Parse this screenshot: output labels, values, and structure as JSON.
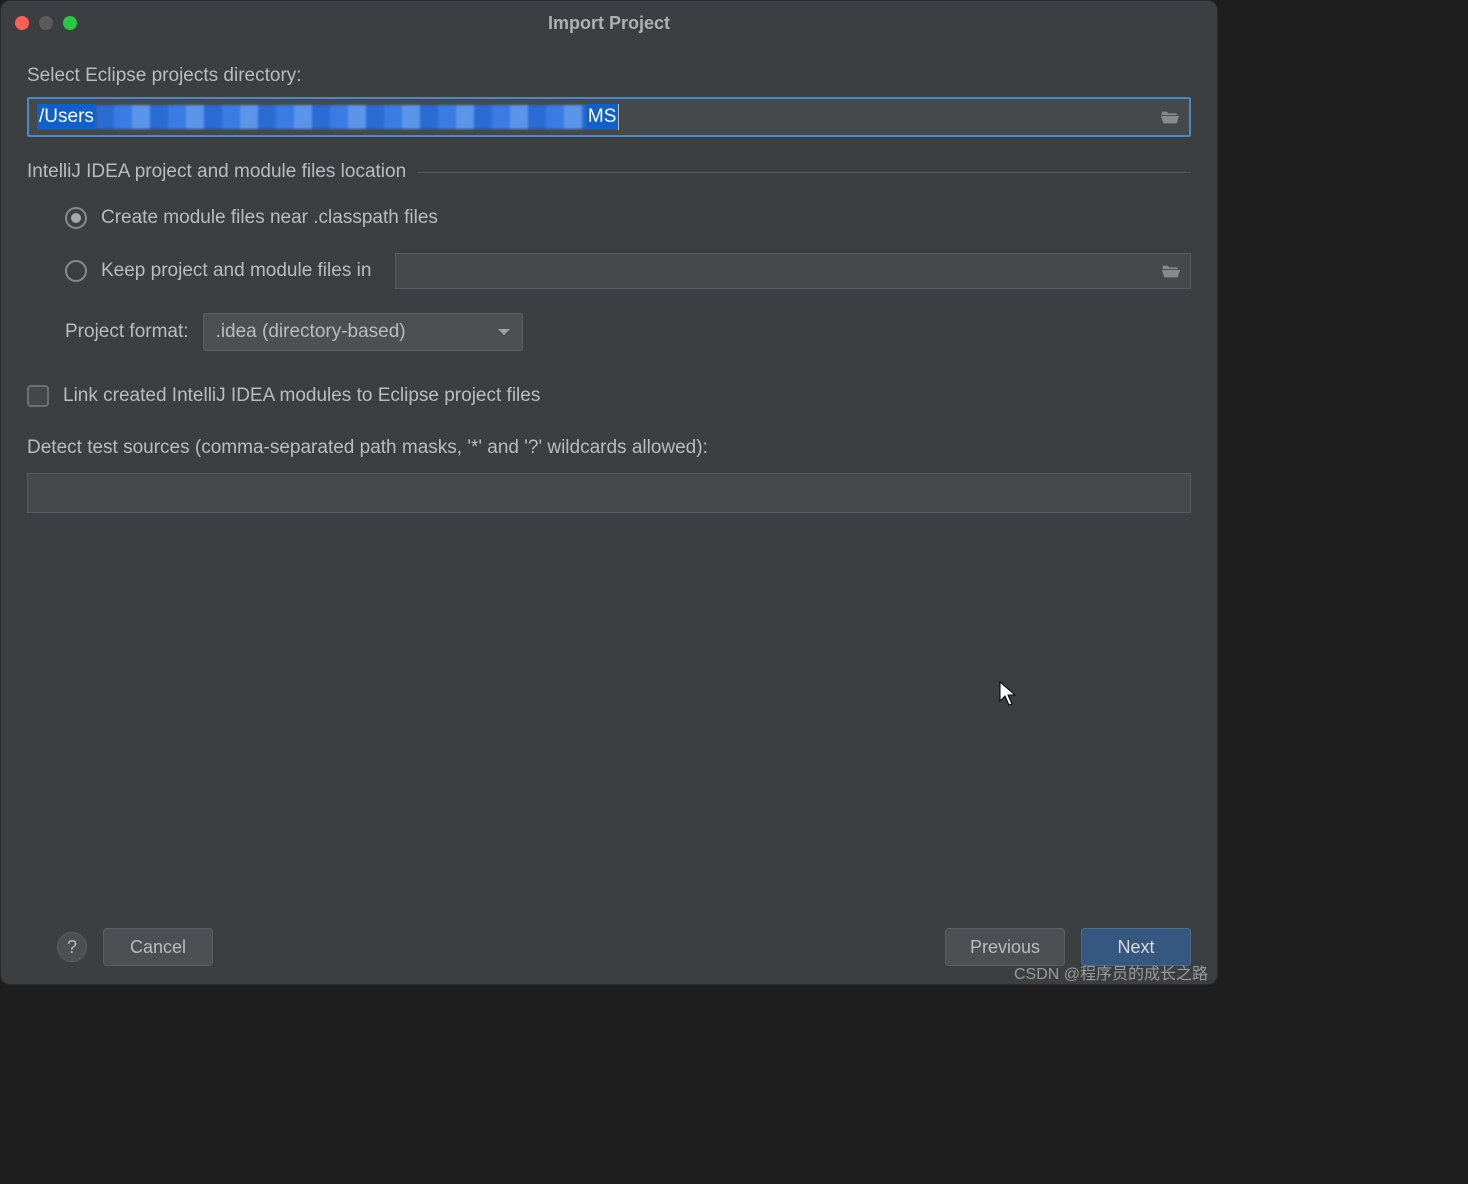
{
  "window": {
    "title": "Import Project"
  },
  "labels": {
    "select_dir": "Select Eclipse projects directory:",
    "section": "IntelliJ IDEA project and module files location",
    "radio_create": "Create module files near .classpath files",
    "radio_keep": "Keep project and module files in",
    "project_format": "Project format:",
    "link_modules": "Link created IntelliJ IDEA modules to Eclipse project files",
    "detect": "Detect test sources (comma-separated path masks, '*' and '?' wildcards allowed):"
  },
  "path": {
    "prefix": "/Users",
    "suffix": "MS"
  },
  "keep_path": "",
  "dropdown": {
    "selected": ".idea (directory-based)"
  },
  "detect_value": "",
  "buttons": {
    "help": "?",
    "cancel": "Cancel",
    "previous": "Previous",
    "next": "Next"
  },
  "watermark": "CSDN @程序员的成长之路"
}
